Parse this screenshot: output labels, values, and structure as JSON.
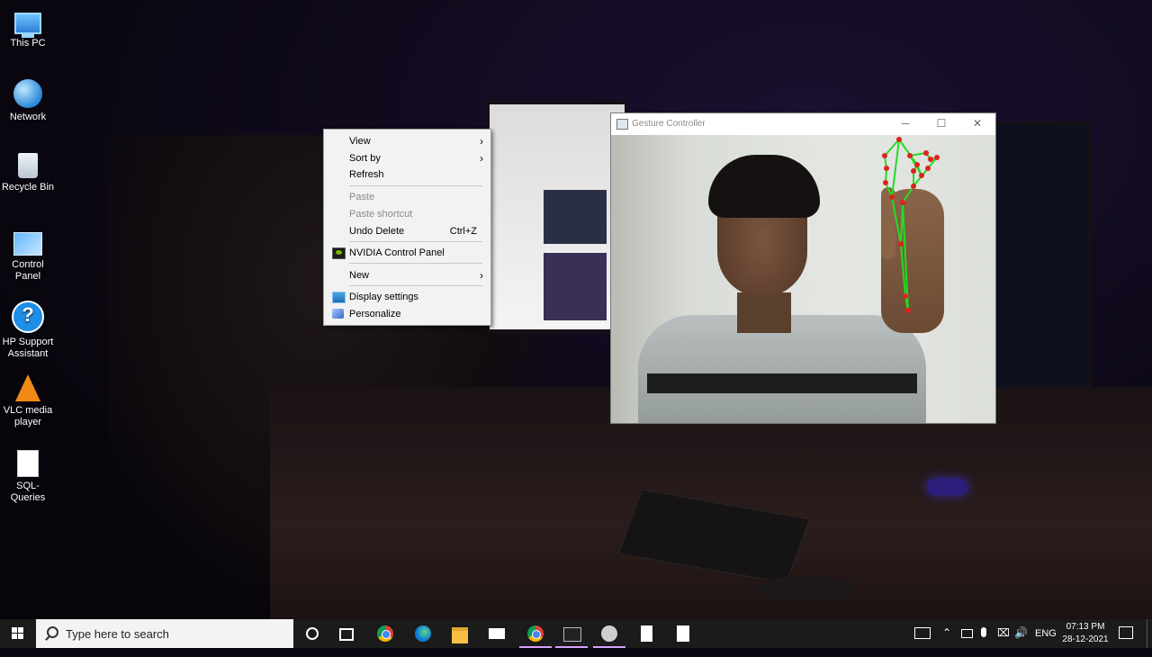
{
  "desktop": {
    "icons": [
      {
        "label": "This PC",
        "icon": "computer-icon"
      },
      {
        "label": "Network",
        "icon": "network-globe-icon"
      },
      {
        "label": "Recycle Bin",
        "icon": "recycle-bin-icon"
      },
      {
        "label": "Control Panel",
        "icon": "control-panel-icon"
      },
      {
        "label": "HP Support Assistant",
        "icon": "help-question-icon"
      },
      {
        "label": "VLC media player",
        "icon": "vlc-cone-icon"
      },
      {
        "label": "SQL-Queries",
        "icon": "text-file-icon"
      }
    ]
  },
  "context_menu": {
    "items": [
      {
        "label": "View",
        "submenu": true,
        "enabled": true
      },
      {
        "label": "Sort by",
        "submenu": true,
        "enabled": true
      },
      {
        "label": "Refresh",
        "enabled": true
      },
      {
        "label": "Paste",
        "enabled": false
      },
      {
        "label": "Paste shortcut",
        "enabled": false
      },
      {
        "label": "Undo Delete",
        "shortcut": "Ctrl+Z",
        "enabled": true
      },
      {
        "label": "NVIDIA Control Panel",
        "icon": "nvidia-icon",
        "enabled": true
      },
      {
        "label": "New",
        "submenu": true,
        "enabled": true
      },
      {
        "label": "Display settings",
        "icon": "display-icon",
        "enabled": true
      },
      {
        "label": "Personalize",
        "icon": "personalize-icon",
        "enabled": true
      }
    ],
    "submenu_glyph": "›"
  },
  "gesture_window": {
    "title": "Gesture Controller",
    "controls": {
      "minimize": "─",
      "maximize": "☐",
      "close": "✕"
    },
    "landmark_color": "#e02020",
    "skeleton_color": "#22dd22"
  },
  "taskbar": {
    "search_placeholder": "Type here to search",
    "pinned": [
      {
        "name": "cortana",
        "icon": "cortana-circle-icon"
      },
      {
        "name": "task-view",
        "icon": "task-view-icon"
      },
      {
        "name": "chrome",
        "icon": "chrome-icon"
      },
      {
        "name": "edge",
        "icon": "edge-icon"
      },
      {
        "name": "file-explorer",
        "icon": "folder-icon"
      },
      {
        "name": "mail",
        "icon": "mail-icon"
      },
      {
        "name": "chrome-running",
        "icon": "chrome-icon",
        "active": true
      },
      {
        "name": "terminal",
        "icon": "terminal-icon",
        "active": true
      },
      {
        "name": "obs",
        "icon": "obs-icon",
        "active": true
      },
      {
        "name": "notepad",
        "icon": "notepad-icon"
      },
      {
        "name": "calculator",
        "icon": "calculator-icon"
      }
    ],
    "tray": {
      "language": "ENG",
      "time": "07:13 PM",
      "date": "28-12-2021"
    },
    "accent_underline": "#d9a0ff"
  }
}
